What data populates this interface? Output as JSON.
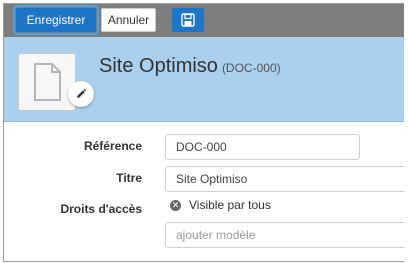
{
  "toolbar": {
    "save_label": "Enregistrer",
    "cancel_label": "Annuler",
    "icon_button": "floppy-disk-icon"
  },
  "header": {
    "title": "Site Optimiso",
    "code": "(DOC-000)",
    "thumbnail_icon": "document-icon",
    "edit_icon": "pencil-icon"
  },
  "form": {
    "reference_label": "Référence",
    "reference_value": "DOC-000",
    "title_label": "Titre",
    "title_value": "Site Optimiso",
    "access_label": "Droits d'accès",
    "access_value": "Visible par tous",
    "model_placeholder": "ajouter modèle"
  },
  "colors": {
    "primary": "#1e74c7",
    "header_bg": "#a9d0ef",
    "toolbar_bg": "#7d7d7d"
  }
}
